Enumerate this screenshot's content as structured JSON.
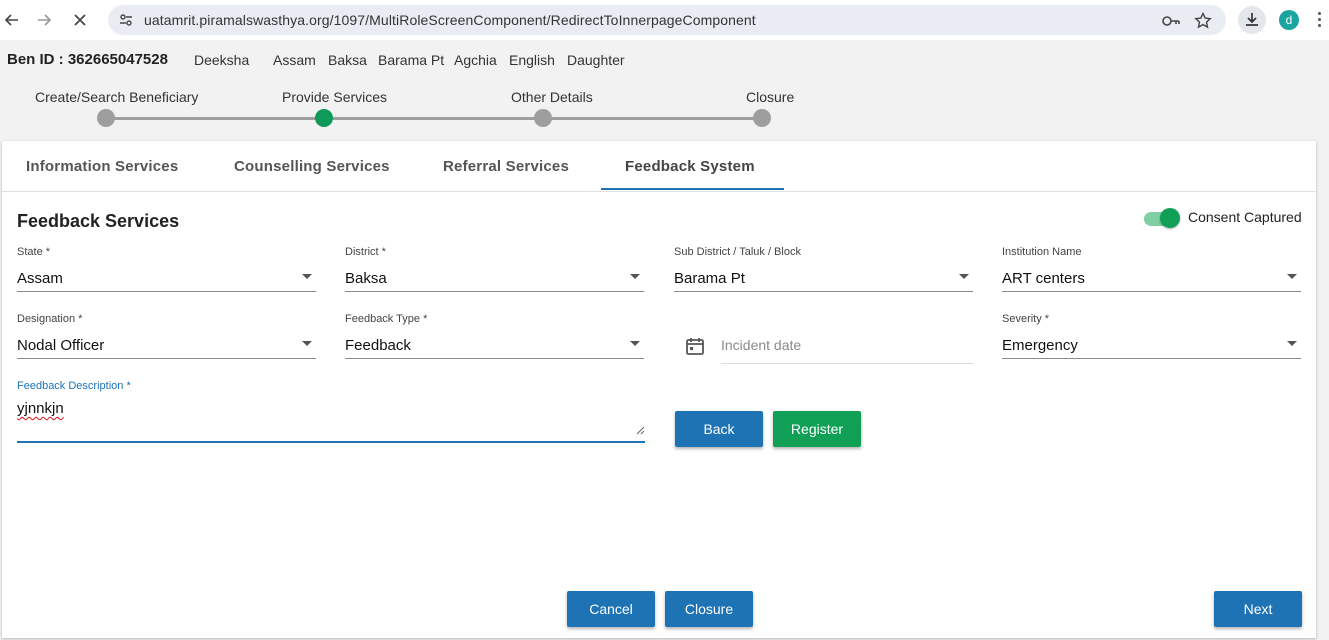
{
  "browser": {
    "url": "uatamrit.piramalswasthya.org/1097/MultiRoleScreenComponent/RedirectToInnerpageComponent",
    "avatar_letter": "d"
  },
  "beneficiary": {
    "ben_id": "Ben ID : 362665047528",
    "name": "Deeksha",
    "state": "Assam",
    "district": "Baksa",
    "subdistrict": "Barama Pt",
    "village": "Agchia",
    "language": "English",
    "relation": "Daughter"
  },
  "stepper": {
    "steps": [
      {
        "label": "Create/Search Beneficiary",
        "active": false
      },
      {
        "label": "Provide Services",
        "active": true
      },
      {
        "label": "Other Details",
        "active": false
      },
      {
        "label": "Closure",
        "active": false
      }
    ],
    "active_color": "#0f9a5a",
    "inactive_color": "#9e9e9e"
  },
  "tabs": [
    {
      "label": "Information Services"
    },
    {
      "label": "Counselling Services"
    },
    {
      "label": "Referral Services"
    },
    {
      "label": "Feedback System",
      "active": true
    }
  ],
  "form": {
    "title": "Feedback Services",
    "consent_label": "Consent Captured",
    "consent_on": true,
    "state": {
      "label": "State *",
      "value": "Assam"
    },
    "district": {
      "label": "District *",
      "value": "Baksa"
    },
    "subdistrict": {
      "label": "Sub District / Taluk / Block",
      "value": "Barama Pt"
    },
    "institution": {
      "label": "Institution Name",
      "value": "ART centers"
    },
    "designation": {
      "label": "Designation *",
      "value": "Nodal Officer"
    },
    "feedback_type": {
      "label": "Feedback Type *",
      "value": "Feedback"
    },
    "incident_date": {
      "placeholder": "Incident date"
    },
    "severity": {
      "label": "Severity *",
      "value": "Emergency"
    },
    "description": {
      "label": "Feedback Description *",
      "value": "yjnnkjn"
    }
  },
  "buttons": {
    "back": "Back",
    "register": "Register",
    "cancel": "Cancel",
    "closure": "Closure",
    "next": "Next"
  },
  "colors": {
    "primary_blue": "#1e73b5",
    "success_green": "#10a055"
  }
}
